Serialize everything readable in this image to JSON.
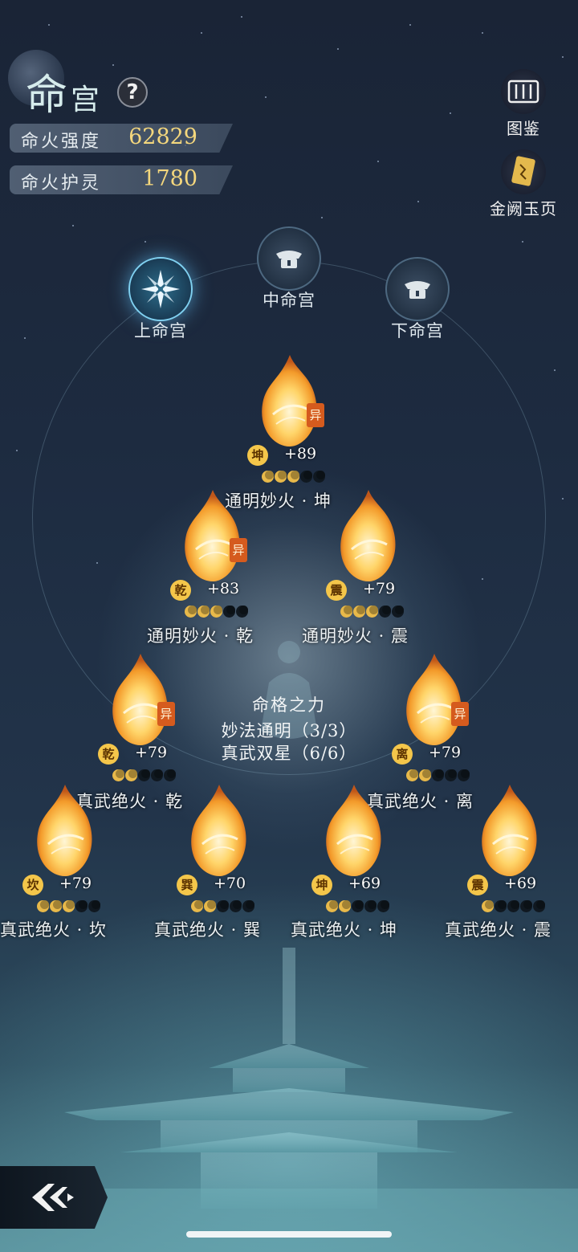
{
  "header": {
    "title_big": "命",
    "title_small": "宫",
    "help_label": "?"
  },
  "stats": [
    {
      "label": "命火强度",
      "value": "62829"
    },
    {
      "label": "命火护灵",
      "value": "1780"
    }
  ],
  "side_buttons": [
    {
      "label": "图鉴",
      "icon": "scroll-icon"
    },
    {
      "label": "金阙玉页",
      "icon": "golden-page-icon"
    }
  ],
  "palaces": [
    {
      "label": "上命宫",
      "state": "active"
    },
    {
      "label": "中命宫",
      "state": "inactive"
    },
    {
      "label": "下命宫",
      "state": "inactive"
    }
  ],
  "nodes": [
    {
      "name": "通明妙火 · 坤",
      "badge": "坤",
      "bonus": "+89",
      "rare": "异",
      "level": 3,
      "max": 5
    },
    {
      "name": "通明妙火 · 乾",
      "badge": "乾",
      "bonus": "+83",
      "rare": "异",
      "level": 3,
      "max": 5
    },
    {
      "name": "通明妙火 · 震",
      "badge": "震",
      "bonus": "+79",
      "rare": "",
      "level": 3,
      "max": 5
    },
    {
      "name": "真武绝火 · 乾",
      "badge": "乾",
      "bonus": "+79",
      "rare": "异",
      "level": 2,
      "max": 5
    },
    {
      "name": "真武绝火 · 离",
      "badge": "离",
      "bonus": "+79",
      "rare": "异",
      "level": 2,
      "max": 5
    },
    {
      "name": "真武绝火 · 坎",
      "badge": "坎",
      "bonus": "+79",
      "rare": "",
      "level": 3,
      "max": 5
    },
    {
      "name": "真武绝火 · 巽",
      "badge": "巽",
      "bonus": "+70",
      "rare": "",
      "level": 2,
      "max": 5
    },
    {
      "name": "真武绝火 · 坤",
      "badge": "坤",
      "bonus": "+69",
      "rare": "",
      "level": 2,
      "max": 5
    },
    {
      "name": "真武绝火 · 震",
      "badge": "震",
      "bonus": "+69",
      "rare": "",
      "level": 1,
      "max": 5
    }
  ],
  "center": {
    "title": "命格之力",
    "lines": [
      "妙法通明（3/3）",
      "真武双星（6/6）"
    ]
  },
  "colors": {
    "accent_gold": "#f4d77d",
    "flame_orange": "#f39a2a",
    "active_blue": "#7fd0f0"
  }
}
